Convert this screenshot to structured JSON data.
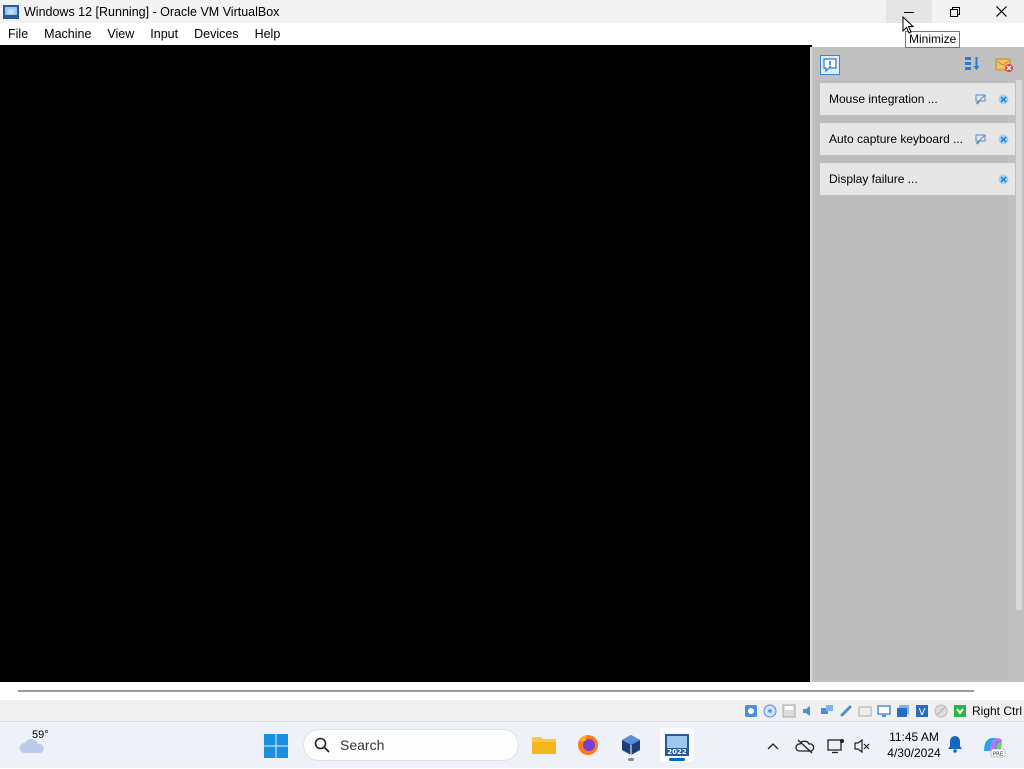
{
  "window": {
    "title": "Windows 12 [Running] - Oracle VM VirtualBox",
    "minimize_tooltip": "Minimize"
  },
  "menu": {
    "items": [
      "File",
      "Machine",
      "View",
      "Input",
      "Devices",
      "Help"
    ]
  },
  "notifications": {
    "items": [
      {
        "label": "Mouse integration ...",
        "has_suppress": true
      },
      {
        "label": "Auto capture keyboard ...",
        "has_suppress": true
      },
      {
        "label": "Display failure ...",
        "has_suppress": false
      }
    ]
  },
  "statusbar": {
    "host_key": "Right Ctrl"
  },
  "taskbar": {
    "weather_temp": "59°",
    "search_placeholder": "Search",
    "time": "11:45 AM",
    "date": "4/30/2024"
  }
}
